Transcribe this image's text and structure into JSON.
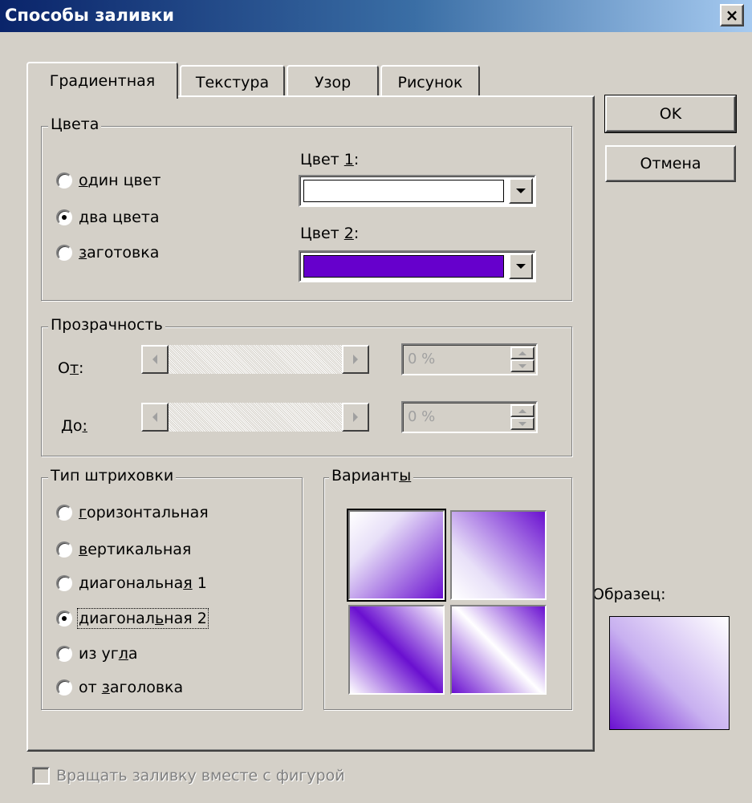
{
  "window": {
    "title": "Способы заливки",
    "close_label": "×"
  },
  "tabs": [
    {
      "label": "Градиентная",
      "active": true
    },
    {
      "label": "Текстура",
      "active": false
    },
    {
      "label": "Узор",
      "active": false
    },
    {
      "label": "Рисунок",
      "active": false
    }
  ],
  "colors_group": {
    "title": "Цвета",
    "options": [
      {
        "prefix": "",
        "accel": "о",
        "rest": "дин цвет",
        "checked": false
      },
      {
        "prefix": "",
        "accel": "д",
        "rest": "ва цвета",
        "checked": true
      },
      {
        "prefix": "",
        "accel": "з",
        "rest": "аготовка",
        "checked": false
      }
    ],
    "color1": {
      "label_prefix": "Цвет ",
      "label_accel": "1",
      "label_suffix": ":",
      "value": "#ffffff"
    },
    "color2": {
      "label_prefix": "Цвет ",
      "label_accel": "2",
      "label_suffix": ":",
      "value": "#6600cc"
    }
  },
  "transparency_group": {
    "title": "Прозрачность",
    "from": {
      "label_prefix": "О",
      "label_accel": "т",
      "label_suffix": ":",
      "value": "0 %"
    },
    "to": {
      "label_prefix": "До",
      "label_accel": ":",
      "label_suffix": "",
      "value": "0 %"
    }
  },
  "shading_group": {
    "title": "Тип штриховки",
    "options": [
      {
        "prefix": "",
        "accel": "г",
        "rest": "оризонтальная",
        "checked": false
      },
      {
        "prefix": "",
        "accel": "в",
        "rest": "ертикальная",
        "checked": false
      },
      {
        "prefix": "диагональна",
        "accel": "я",
        "rest": " 1",
        "checked": false
      },
      {
        "prefix": "диагонал",
        "accel": "ь",
        "rest": "ная 2",
        "checked": true
      },
      {
        "prefix": "из уг",
        "accel": "л",
        "rest": "а",
        "checked": false
      },
      {
        "prefix": "от ",
        "accel": "з",
        "rest": "аголовка",
        "checked": false
      }
    ]
  },
  "variants_group": {
    "title_prefix": "Вариант",
    "title_accel": "ы"
  },
  "sample": {
    "label": "Образец:"
  },
  "buttons": {
    "ok": "OK",
    "cancel": "Отмена"
  },
  "rotate_checkbox": {
    "label": "Вращать заливку вместе с фигурой",
    "checked": false,
    "enabled": false
  }
}
